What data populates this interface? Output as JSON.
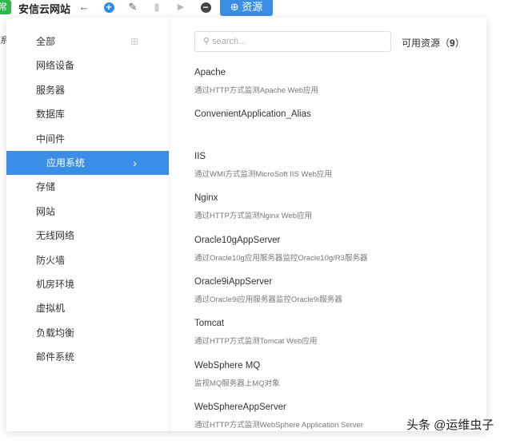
{
  "topbar": {
    "badge": "常",
    "title": "安信云网站",
    "add_resource": "资源",
    "left_fragment": "系"
  },
  "categories": [
    "全部",
    "网络设备",
    "服务器",
    "数据库",
    "中间件",
    "应用系统",
    "存储",
    "网站",
    "无线网络",
    "防火墙",
    "机房环境",
    "虚拟机",
    "负载均衡",
    "邮件系统"
  ],
  "search": {
    "placeholder": "search..."
  },
  "available": {
    "label": "可用资源",
    "count": "9"
  },
  "resources": [
    {
      "name": "Apache",
      "desc": "通过HTTP方式监测Apache Web应用"
    },
    {
      "name": "ConvenientApplication_Alias",
      "desc": ""
    },
    {
      "name": "IIS",
      "desc": "通过WMI方式监测MicroSoft IIS Web应用"
    },
    {
      "name": "Nginx",
      "desc": "通过HTTP方式监测Nginx Web应用"
    },
    {
      "name": "Oracle10gAppServer",
      "desc": "通过Oracle10g应用服务器监控Oracle10g/R3服务器"
    },
    {
      "name": "Oracle9iAppServer",
      "desc": "通过Oracle9i应用服务器监控Oracle9i服务器"
    },
    {
      "name": "Tomcat",
      "desc": "通过HTTP方式监测Tomcat Web应用"
    },
    {
      "name": "WebSphere MQ",
      "desc": "监视MQ服务器上MQ对象"
    },
    {
      "name": "WebSphereAppServer",
      "desc": "通过HTTP方式监测WebSphere Application Server"
    }
  ],
  "watermark": "头条 @运维虫子"
}
